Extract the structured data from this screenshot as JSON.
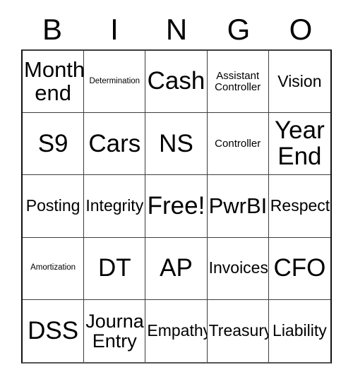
{
  "card": {
    "title": "BINGO",
    "header_letters": [
      "B",
      "I",
      "N",
      "G",
      "O"
    ],
    "free_space_label": "Free!",
    "grid_size": "5x5",
    "colors": {
      "background": "#ffffff",
      "text": "#000000",
      "grid_line": "#3d3d3d",
      "border": "#111111"
    },
    "rows": [
      [
        {
          "text": "Month\nend",
          "size": "xl"
        },
        {
          "text": "Determination",
          "size": "xxs"
        },
        {
          "text": "Cash",
          "size": "xxl"
        },
        {
          "text": "Assistant\nController",
          "size": "xs"
        },
        {
          "text": "Vision",
          "size": "md"
        }
      ],
      [
        {
          "text": "S9",
          "size": "xxl"
        },
        {
          "text": "Cars",
          "size": "xxl"
        },
        {
          "text": "NS",
          "size": "xxl"
        },
        {
          "text": "Controller",
          "size": "xs"
        },
        {
          "text": "Year\nEnd",
          "size": "xxl"
        }
      ],
      [
        {
          "text": "Posting",
          "size": "md"
        },
        {
          "text": "Integrity",
          "size": "md"
        },
        {
          "text": "Free!",
          "size": "xxl"
        },
        {
          "text": "PwrBI",
          "size": "xl"
        },
        {
          "text": "Respect",
          "size": "md"
        }
      ],
      [
        {
          "text": "Amortization",
          "size": "xxs"
        },
        {
          "text": "DT",
          "size": "xxl"
        },
        {
          "text": "AP",
          "size": "xxl"
        },
        {
          "text": "Invoices",
          "size": "md"
        },
        {
          "text": "CFO",
          "size": "xxl"
        }
      ],
      [
        {
          "text": "DSS",
          "size": "xxl"
        },
        {
          "text": "Journal\nEntry",
          "size": "lg"
        },
        {
          "text": "Empathy",
          "size": "md"
        },
        {
          "text": "Treasury",
          "size": "md"
        },
        {
          "text": "Liability",
          "size": "md"
        }
      ]
    ]
  }
}
